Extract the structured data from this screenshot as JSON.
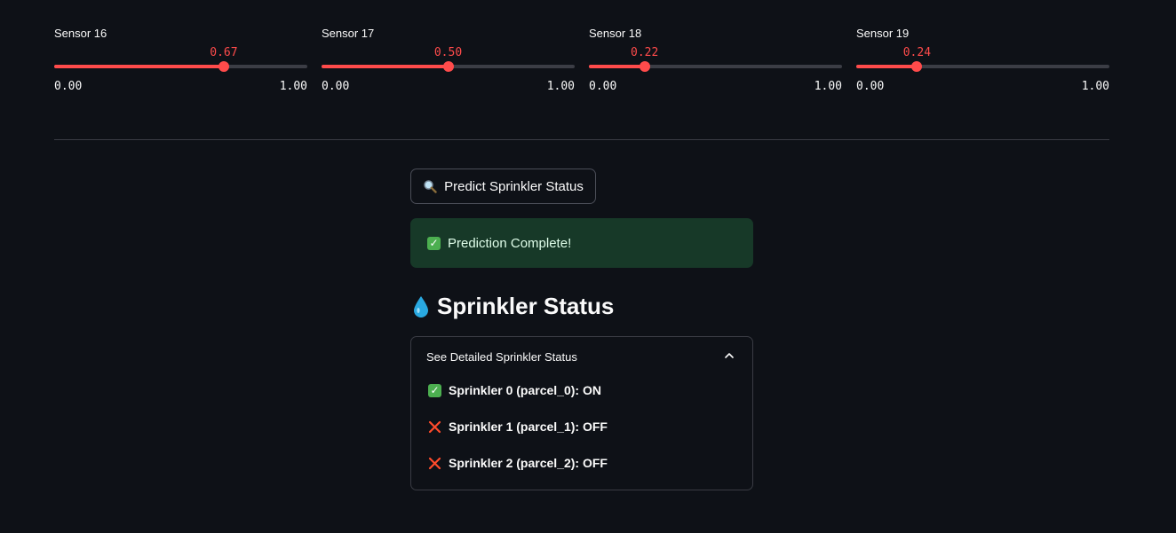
{
  "sliders": [
    {
      "label": "Sensor 16",
      "value": 0.67,
      "value_text": "0.67",
      "min": "0.00",
      "max": "1.00"
    },
    {
      "label": "Sensor 17",
      "value": 0.5,
      "value_text": "0.50",
      "min": "0.00",
      "max": "1.00"
    },
    {
      "label": "Sensor 18",
      "value": 0.22,
      "value_text": "0.22",
      "min": "0.00",
      "max": "1.00"
    },
    {
      "label": "Sensor 19",
      "value": 0.24,
      "value_text": "0.24",
      "min": "0.00",
      "max": "1.00"
    }
  ],
  "predict_button": {
    "icon": "magnifier-icon",
    "label": "Predict Sprinkler Status"
  },
  "success_alert": {
    "icon": "check-icon",
    "text": "Prediction Complete!"
  },
  "status_section": {
    "icon": "droplet-icon",
    "title": "Sprinkler Status"
  },
  "expander": {
    "label": "See Detailed Sprinkler Status",
    "expanded": true,
    "items": [
      {
        "icon": "check-icon",
        "text": "Sprinkler 0 (parcel_0): ON"
      },
      {
        "icon": "cross-icon",
        "text": "Sprinkler 1 (parcel_1): OFF"
      },
      {
        "icon": "cross-icon",
        "text": "Sprinkler 2 (parcel_2): OFF"
      }
    ]
  },
  "colors": {
    "background": "#0e1117",
    "accent": "#ff4b4b",
    "success_bg": "#173928",
    "success_text": "#dffde9",
    "cross": "#ff4b2b",
    "check": "#4caf50"
  }
}
